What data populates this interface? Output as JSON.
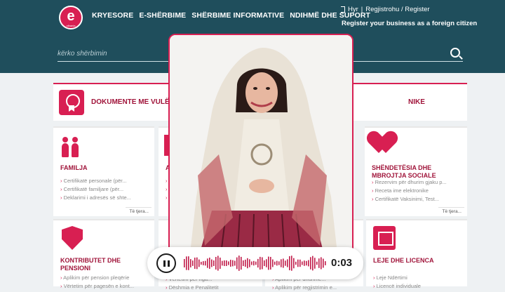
{
  "header": {
    "logo_letter": "e",
    "logo_sub": "albania",
    "nav": [
      "KRYESORE",
      "E-SHËRBIME",
      "SHËRBIME INFORMATIVE",
      "NDIHMË DHE SUPORT"
    ],
    "login_label": "Hyr",
    "separator": "|",
    "register_label": "Regjistrohu / Register",
    "foreign_label": "Register your business as a foreign citizen"
  },
  "search": {
    "placeholder": "kërko shërbimin"
  },
  "banner": {
    "title_left": "DOKUMENTE ME VULË EL",
    "title_right": "NIKE"
  },
  "cards": {
    "family": {
      "title": "FAMILJA",
      "items": [
        "Certifikatë personale (për...",
        "Certifikatë familjare (për...",
        "Deklarimi i adresës së shte..."
      ],
      "more": "Të tjera..."
    },
    "partial": {
      "title": "A"
    },
    "health": {
      "title_line1": "SHËNDETËSIA DHE",
      "title_line2": "MBROJTJA SOCIALE",
      "items": [
        "Rezervim për dhurim gjaku p...",
        "Receta ime elektronike",
        "Certifikatë Vaksinimi, Test..."
      ],
      "more": "Të tjera..."
    },
    "pension": {
      "title_line1": "KONTRIBUTET DHE",
      "title_line2": "PENSIONI",
      "items": [
        "Aplikim për pension pleqërie",
        "Vërtetim për pagesën e kont..."
      ]
    },
    "license": {
      "title": "LEJE DHE LICENCA",
      "items": [
        "Leje Ndërtimi",
        "Licencë individuale"
      ]
    },
    "mid_a": {
      "items": [
        "Vërtetim për nga...",
        "Dëshmia e Penalitetit"
      ]
    },
    "mid_b": {
      "items": [
        "Aplikim për dhurime...",
        "Aplikim për regjistrimin e..."
      ]
    }
  },
  "player": {
    "time": "0:03",
    "icon": "pause-icon"
  },
  "colors": {
    "header": "#1f4e5c",
    "accent": "#d81f52"
  }
}
